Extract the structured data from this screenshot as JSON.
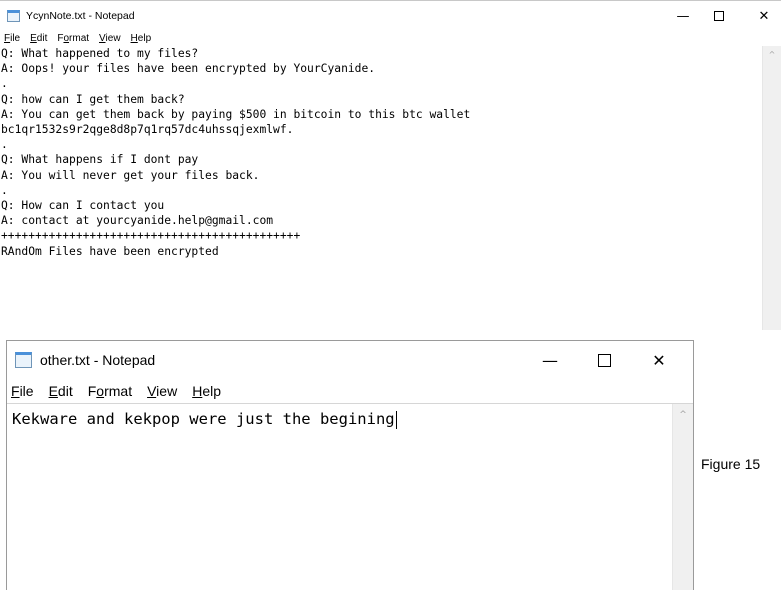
{
  "window1": {
    "title": "YcynNote.txt - Notepad",
    "menu": [
      {
        "key": "F",
        "rest": "ile"
      },
      {
        "key": "E",
        "rest": "dit"
      },
      {
        "pre": "F",
        "key": "o",
        "rest": "rmat"
      },
      {
        "key": "V",
        "rest": "iew"
      },
      {
        "key": "H",
        "rest": "elp"
      }
    ],
    "lines": [
      "Q: What happened to my files?",
      "A: Oops! your files have been encrypted by YourCyanide.",
      ".",
      "Q: how can I get them back?",
      "A: You can get them back by paying $500 in bitcoin to this btc wallet",
      "bc1qr1532s9r2qge8d8p7q1rq57dc4uhssqjexmlwf.",
      ".",
      "Q: What happens if I dont pay",
      "A: You will never get your files back.",
      ".",
      "Q: How can I contact you",
      "A: contact at yourcyanide.help@gmail.com",
      "++++++++++++++++++++++++++++++++++++++++++++",
      "RAndOm Files have been encrypted"
    ]
  },
  "window2": {
    "title": "other.txt - Notepad",
    "menu": [
      {
        "key": "F",
        "rest": "ile"
      },
      {
        "key": "E",
        "rest": "dit"
      },
      {
        "pre": "F",
        "key": "o",
        "rest": "rmat"
      },
      {
        "key": "V",
        "rest": "iew"
      },
      {
        "key": "H",
        "rest": "elp"
      }
    ],
    "text": "Kekware and kekpop were just the begining"
  },
  "window_controls": {
    "minimize": "—",
    "close": "✕"
  },
  "icons": {
    "notepad": "notepad-icon",
    "minimize": "minimize-icon",
    "maximize": "maximize-icon",
    "close": "close-icon",
    "scroll_up": "scroll-up-arrow-icon"
  },
  "scroll_arrow": "^",
  "caption": "Figure 15"
}
